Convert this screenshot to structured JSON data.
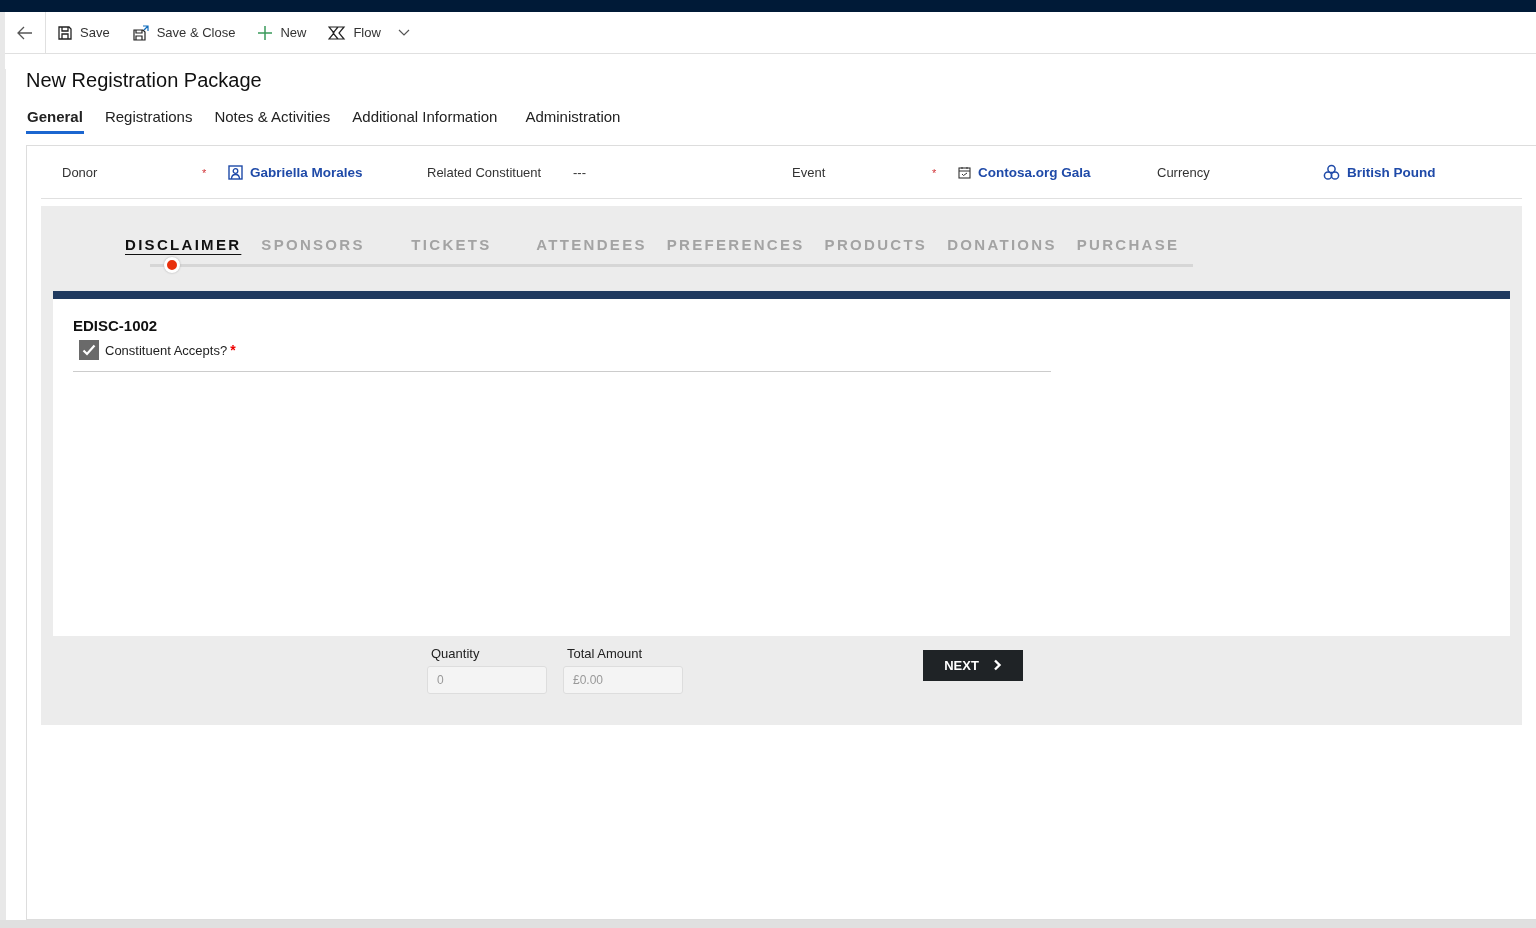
{
  "toolbar": {
    "items": [
      {
        "label": "Save",
        "kind": "save"
      },
      {
        "label": "Save & Close",
        "kind": "save-close"
      },
      {
        "label": "New",
        "kind": "new"
      },
      {
        "label": "Flow",
        "kind": "flow"
      }
    ]
  },
  "title": "New Registration Package",
  "tabs": [
    {
      "label": "General",
      "selected": true
    },
    {
      "label": "Registrations",
      "selected": false
    },
    {
      "label": "Notes & Activities",
      "selected": false
    },
    {
      "label": "Additional Information",
      "selected": false
    },
    {
      "label": "Administration",
      "selected": false
    }
  ],
  "header_fields": [
    {
      "label": "Donor",
      "required_mark": "*",
      "kind": "person",
      "value": "Gabriella Morales"
    },
    {
      "label": "Related Constituent",
      "kind": "empty",
      "value": "---"
    },
    {
      "label": "Event",
      "required_mark": "*",
      "kind": "event",
      "value": "Contosa.org Gala"
    },
    {
      "label": "Currency",
      "kind": "currency",
      "value": "British Pound"
    }
  ],
  "steps": [
    {
      "label": "DISCLAIMER",
      "selected": true
    },
    {
      "label": "SPONSORS",
      "selected": false
    },
    {
      "label": "TICKETS",
      "selected": false
    },
    {
      "label": "ATTENDEES",
      "selected": false
    },
    {
      "label": "PREFERENCES",
      "selected": false
    },
    {
      "label": "PRODUCTS",
      "selected": false
    },
    {
      "label": "DONATIONS",
      "selected": false
    },
    {
      "label": "PURCHASE",
      "selected": false
    }
  ],
  "disclaimer": {
    "code": "EDISC-1002",
    "label": "Constituent Accepts?",
    "required_mark": "*",
    "checked": true
  },
  "totals": [
    {
      "label": "Quantity",
      "placeholder": "0"
    },
    {
      "label": "Total Amount",
      "placeholder": "£0.00"
    }
  ],
  "next_button": "NEXT"
}
